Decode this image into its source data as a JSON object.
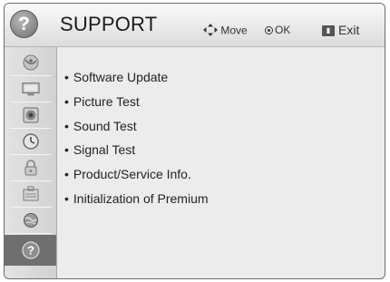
{
  "header": {
    "icon": "question-icon",
    "title": "SUPPORT",
    "move_label": "Move",
    "ok_label": "OK",
    "exit_label": "Exit"
  },
  "sidebar": {
    "items": [
      {
        "icon": "satellite-dish-icon"
      },
      {
        "icon": "monitor-icon"
      },
      {
        "icon": "speaker-icon"
      },
      {
        "icon": "clock-icon"
      },
      {
        "icon": "lock-icon"
      },
      {
        "icon": "options-box-icon"
      },
      {
        "icon": "network-globe-icon"
      },
      {
        "icon": "question-icon",
        "active": true
      }
    ]
  },
  "menu": {
    "items": [
      "Software Update",
      "Picture Test",
      "Sound Test",
      "Signal Test",
      "Product/Service Info.",
      "Initialization of Premium"
    ]
  }
}
